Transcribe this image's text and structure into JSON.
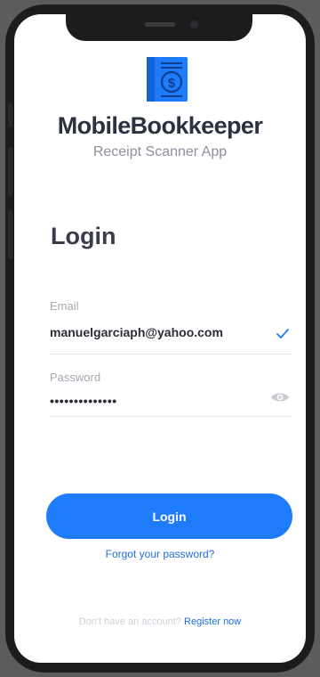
{
  "app": {
    "name": "MobileBookkeeper",
    "tagline": "Receipt Scanner App",
    "logo_icon": "receipt-dollar-icon",
    "brand_color": "#1e7cfb"
  },
  "form": {
    "title": "Login",
    "email": {
      "label": "Email",
      "value": "manuelgarciaph@yahoo.com",
      "status_icon": "check-icon"
    },
    "password": {
      "label": "Password",
      "value": "••••••••••••••",
      "toggle_icon": "eye-icon"
    },
    "submit_label": "Login",
    "forgot_label": "Forgot your password?"
  },
  "footer": {
    "prompt": "Don't have an account?",
    "register_label": "Register now"
  }
}
